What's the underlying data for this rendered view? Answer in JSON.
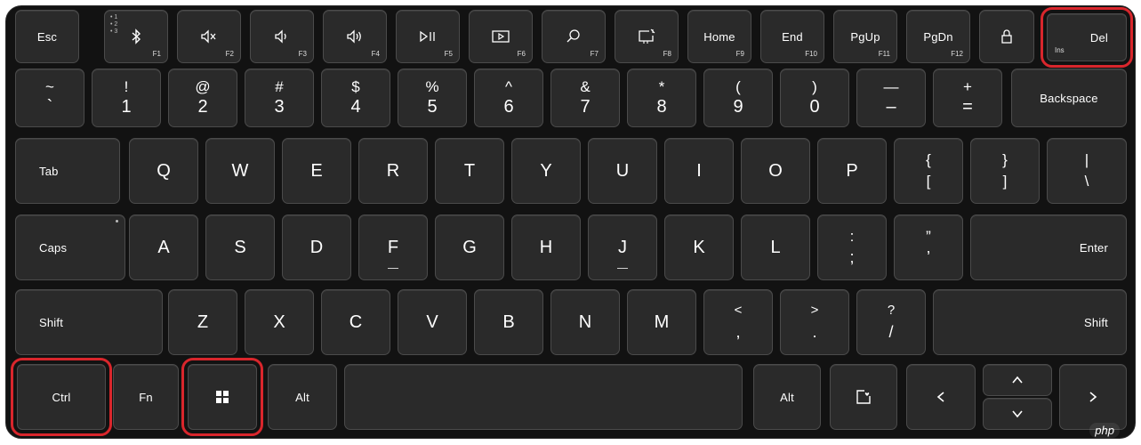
{
  "function_row": {
    "esc": "Esc",
    "f1": "F1",
    "f2": "F2",
    "f3": "F3",
    "f4": "F4",
    "f5": "F5",
    "f6": "F6",
    "f7": "F7",
    "f8": "F8",
    "f9": "F9",
    "f10": "F10",
    "f11": "F11",
    "f12": "F12",
    "bt_indicators": [
      "1",
      "2",
      "3"
    ],
    "home": "Home",
    "end": "End",
    "pgup": "PgUp",
    "pgdn": "PgDn",
    "del": "Del",
    "ins": "Ins"
  },
  "number_row": {
    "keys": [
      {
        "top": "~",
        "bottom": "`"
      },
      {
        "top": "!",
        "bottom": "1"
      },
      {
        "top": "@",
        "bottom": "2"
      },
      {
        "top": "#",
        "bottom": "3"
      },
      {
        "top": "$",
        "bottom": "4"
      },
      {
        "top": "%",
        "bottom": "5"
      },
      {
        "top": "^",
        "bottom": "6"
      },
      {
        "top": "&",
        "bottom": "7"
      },
      {
        "top": "*",
        "bottom": "8"
      },
      {
        "top": "(",
        "bottom": "9"
      },
      {
        "top": ")",
        "bottom": "0"
      },
      {
        "top": "—",
        "bottom": "–"
      },
      {
        "top": "+",
        "bottom": "="
      }
    ],
    "backspace": "Backspace"
  },
  "qwerty_row": {
    "tab": "Tab",
    "letters": [
      "Q",
      "W",
      "E",
      "R",
      "T",
      "Y",
      "U",
      "I",
      "O",
      "P"
    ],
    "brace_open": {
      "top": "{",
      "bottom": "["
    },
    "brace_close": {
      "top": "}",
      "bottom": "]"
    },
    "pipe": {
      "top": "|",
      "bottom": "\\"
    }
  },
  "home_row": {
    "caps": "Caps",
    "letters": [
      "A",
      "S",
      "D",
      "F",
      "G",
      "H",
      "J",
      "K",
      "L"
    ],
    "colon": {
      "top": ":",
      "bottom": ";"
    },
    "quote": {
      "top": "”",
      "bottom": "’"
    },
    "enter": "Enter"
  },
  "bottom_letter_row": {
    "shift_left": "Shift",
    "letters": [
      "Z",
      "X",
      "C",
      "V",
      "B",
      "N",
      "M"
    ],
    "comma": {
      "top": "<",
      "bottom": ","
    },
    "period": {
      "top": ">",
      "bottom": "."
    },
    "slash": {
      "top": "?",
      "bottom": "/"
    },
    "shift_right": "Shift"
  },
  "modifier_row": {
    "ctrl": "Ctrl",
    "fn": "Fn",
    "alt_left": "Alt",
    "alt_right": "Alt"
  },
  "icons": {
    "f1": "bluetooth-icon",
    "f2": "mute-icon",
    "f3": "volume-down-icon",
    "f4": "volume-up-icon",
    "f5": "play-pause-icon",
    "f6": "media-icon",
    "f7": "search-icon",
    "f8": "screen-snip-icon",
    "lock": "lock-icon",
    "windows": "windows-logo-icon",
    "favorite": "heart-window-icon",
    "left": "arrow-left-icon",
    "right": "arrow-right-icon",
    "up": "arrow-up-icon",
    "down": "arrow-down-icon"
  },
  "highlighted_keys": [
    "Del",
    "Ctrl",
    "Windows"
  ],
  "colors": {
    "highlight": "#d9262c",
    "keycap": "#2a2a2a",
    "board": "#121212"
  },
  "watermark": "php"
}
